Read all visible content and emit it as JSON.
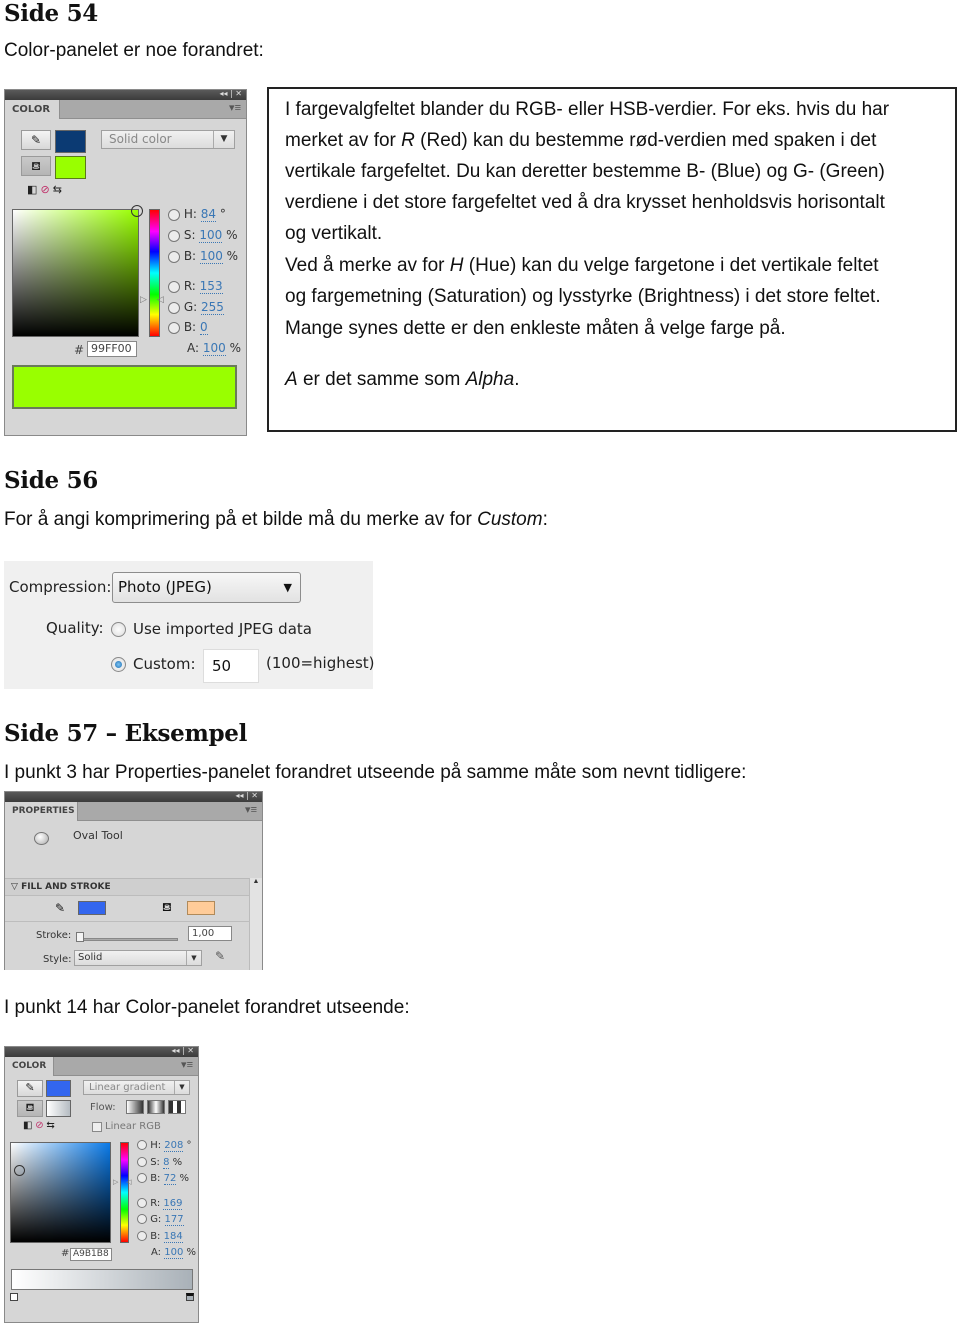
{
  "sections": {
    "s54": {
      "heading": "Side 54",
      "intro": "Color-panelet er noe forandret:"
    },
    "s56": {
      "heading": "Side 56",
      "intro_pre": "For å angi komprimering på et bilde må du merke av for ",
      "intro_em": "Custom",
      "intro_post": ":"
    },
    "s57": {
      "heading": "Side 57 – Eksempel",
      "intro1": "I punkt 3 har Properties-panelet forandret utseende på samme måte som nevnt tidligere:",
      "intro2": "I punkt 14 har Color-panelet forandret utseende:"
    }
  },
  "textbox": {
    "l1": "I fargevalgfeltet blander du RGB- eller HSB-verdier. For eks. hvis du har",
    "l2_pre": "merket av for ",
    "l2_em": "R",
    "l2_post": " (Red) kan du bestemme rød-verdien med spaken i det",
    "l3": "vertikale fargefeltet. Du kan deretter bestemme B- (Blue) og G- (Green)",
    "l4": "verdiene i det store fargefeltet ved å dra krysset henholdsvis horisontalt",
    "l5": "og vertikalt.",
    "l6_pre": "Ved å merke av for ",
    "l6_em": "H",
    "l6_post": " (Hue) kan du velge fargetone i det vertikale feltet",
    "l7": "og fargemetning (Saturation) og lysstyrke (Brightness) i det store feltet.",
    "l8": "Mange synes dette er den enkleste måten å velge farge på.",
    "l9_em1": "A",
    "l9_mid": " er det samme som ",
    "l9_em2": "Alpha",
    "l9_post": "."
  },
  "color_panel_1": {
    "tab": "COLOR",
    "window_controls": "◂◂ | ✕",
    "menu_icon": "▾≡",
    "type_dropdown": "Solid color",
    "stroke_color": "#0b3a73",
    "fill_color": "#99ff00",
    "hsb": [
      {
        "label": "H:",
        "value": "84",
        "unit": "°",
        "selected": true
      },
      {
        "label": "S:",
        "value": "100",
        "unit": "%",
        "selected": false
      },
      {
        "label": "B:",
        "value": "100",
        "unit": "%",
        "selected": false
      }
    ],
    "rgb": [
      {
        "label": "R:",
        "value": "153",
        "selected": false
      },
      {
        "label": "G:",
        "value": "255",
        "selected": false
      },
      {
        "label": "B:",
        "value": "0",
        "selected": false
      }
    ],
    "alpha": {
      "label": "A:",
      "value": "100",
      "unit": "%"
    },
    "hex_label": "#",
    "hex": "99FF00",
    "preview_color": "#99ff00"
  },
  "compression": {
    "compression_label": "Compression:",
    "compression_value": "Photo (JPEG)",
    "quality_label": "Quality:",
    "option_imported": "Use imported JPEG data",
    "option_custom": "Custom:",
    "custom_value": "50",
    "hint": "(100=highest)",
    "selected": "custom"
  },
  "properties_panel": {
    "tab": "PROPERTIES",
    "window_controls": "◂◂ | ✕",
    "menu_icon": "▾≡",
    "tool_name": "Oval Tool",
    "section": "FILL AND STROKE",
    "stroke_color": "#3366ee",
    "fill_color": "#ffcc99",
    "stroke_label": "Stroke:",
    "stroke_value": "1,00",
    "style_label": "Style:",
    "style_value": "Solid"
  },
  "color_panel_2": {
    "tab": "COLOR",
    "window_controls": "◂◂ | ✕",
    "menu_icon": "▾≡",
    "type_dropdown": "Linear gradient",
    "flow_label": "Flow:",
    "linear_rgb_label": "Linear RGB",
    "linear_rgb_checked": false,
    "stroke_color": "#3366ee",
    "hsb": [
      {
        "label": "H:",
        "value": "208",
        "unit": "°",
        "selected": true
      },
      {
        "label": "S:",
        "value": "8",
        "unit": "%",
        "selected": false
      },
      {
        "label": "B:",
        "value": "72",
        "unit": "%",
        "selected": false
      }
    ],
    "rgb": [
      {
        "label": "R:",
        "value": "169",
        "selected": false
      },
      {
        "label": "G:",
        "value": "177",
        "selected": false
      },
      {
        "label": "B:",
        "value": "184",
        "selected": false
      }
    ],
    "alpha": {
      "label": "A:",
      "value": "100",
      "unit": "%"
    },
    "hex_label": "#",
    "hex": "A9B1B8",
    "gradient_stops": [
      "#ffffff",
      "#a9b1b8"
    ]
  }
}
